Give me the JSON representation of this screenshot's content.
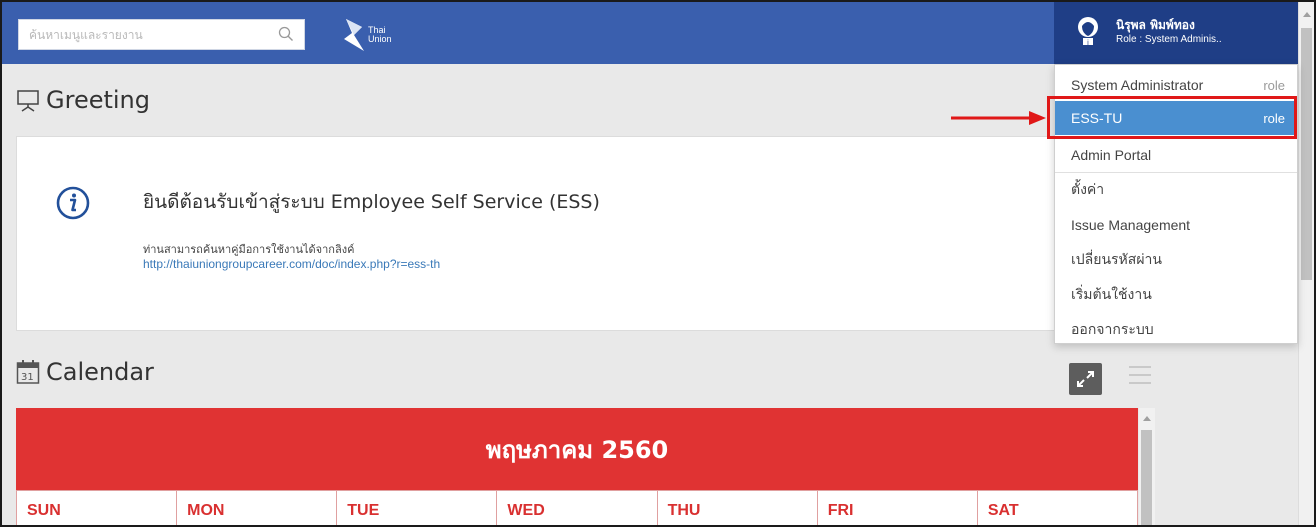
{
  "search": {
    "placeholder": "ค้นหาเมนูและรายงาน"
  },
  "logo": {
    "line1": "Thai",
    "line2": "Union"
  },
  "user": {
    "name": "นิรุพล พิมพ์ทอง",
    "role": "Role : System Adminis.."
  },
  "greeting": {
    "title": "Greeting",
    "heading": "ยินดีต้อนรับเข้าสู่ระบบ Employee Self Service (ESS)",
    "description": "ท่านสามารถค้นหาคู่มือการใช้งานได้จากลิงค์",
    "link": "http://thaiuniongroupcareer.com/doc/index.php?r=ess-th"
  },
  "calendar": {
    "title": "Calendar",
    "icon_day": "31",
    "month": "พฤษภาคม 2560",
    "days": [
      "SUN",
      "MON",
      "TUE",
      "WED",
      "THU",
      "FRI",
      "SAT"
    ]
  },
  "menu": {
    "items": [
      {
        "label": "System Administrator",
        "tag": "role"
      },
      {
        "label": "ESS-TU",
        "tag": "role"
      },
      {
        "label": "Admin Portal",
        "tag": ""
      },
      {
        "label": "ตั้งค่า",
        "tag": ""
      },
      {
        "label": "Issue Management",
        "tag": ""
      },
      {
        "label": "เปลี่ยนรหัสผ่าน",
        "tag": ""
      },
      {
        "label": "เริ่มต้นใช้งาน",
        "tag": ""
      },
      {
        "label": "ออกจากระบบ",
        "tag": ""
      }
    ]
  },
  "colors": {
    "topbar": "#3a5fae",
    "user_panel": "#1f3e86",
    "calendar_header": "#e03333",
    "active_item": "#4a8fd0",
    "highlight": "#e01818"
  },
  "icons": [
    "search-icon",
    "thai-union-logo",
    "user-avatar-icon",
    "presentation-icon",
    "info-icon",
    "calendar-icon",
    "expand-icon",
    "hamburger-menu-icon",
    "annotation-arrow"
  ]
}
